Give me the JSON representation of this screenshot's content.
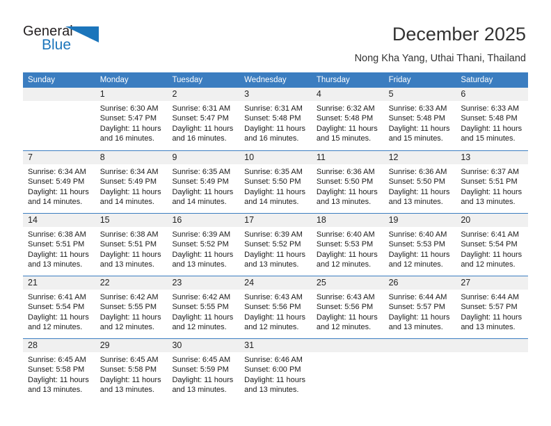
{
  "logo": {
    "word_top": "General",
    "word_bottom": "Blue",
    "accent_color": "#1b75bb",
    "text_color": "#231f20",
    "triangle_icon": "blue-triangle-icon"
  },
  "header": {
    "title": "December 2025",
    "subtitle": "Nong Kha Yang, Uthai Thani, Thailand",
    "header_bar_color": "#3b7dc0",
    "daynum_strip_color": "#f0f0f0"
  },
  "weekdays": [
    "Sunday",
    "Monday",
    "Tuesday",
    "Wednesday",
    "Thursday",
    "Friday",
    "Saturday"
  ],
  "weeks": [
    [
      {
        "day": "",
        "sunrise": "",
        "sunset": "",
        "daylight": "",
        "daylight2": "",
        "empty": true
      },
      {
        "day": "1",
        "sunrise": "Sunrise: 6:30 AM",
        "sunset": "Sunset: 5:47 PM",
        "daylight": "Daylight: 11 hours",
        "daylight2": "and 16 minutes."
      },
      {
        "day": "2",
        "sunrise": "Sunrise: 6:31 AM",
        "sunset": "Sunset: 5:47 PM",
        "daylight": "Daylight: 11 hours",
        "daylight2": "and 16 minutes."
      },
      {
        "day": "3",
        "sunrise": "Sunrise: 6:31 AM",
        "sunset": "Sunset: 5:48 PM",
        "daylight": "Daylight: 11 hours",
        "daylight2": "and 16 minutes."
      },
      {
        "day": "4",
        "sunrise": "Sunrise: 6:32 AM",
        "sunset": "Sunset: 5:48 PM",
        "daylight": "Daylight: 11 hours",
        "daylight2": "and 15 minutes."
      },
      {
        "day": "5",
        "sunrise": "Sunrise: 6:33 AM",
        "sunset": "Sunset: 5:48 PM",
        "daylight": "Daylight: 11 hours",
        "daylight2": "and 15 minutes."
      },
      {
        "day": "6",
        "sunrise": "Sunrise: 6:33 AM",
        "sunset": "Sunset: 5:48 PM",
        "daylight": "Daylight: 11 hours",
        "daylight2": "and 15 minutes."
      }
    ],
    [
      {
        "day": "7",
        "sunrise": "Sunrise: 6:34 AM",
        "sunset": "Sunset: 5:49 PM",
        "daylight": "Daylight: 11 hours",
        "daylight2": "and 14 minutes."
      },
      {
        "day": "8",
        "sunrise": "Sunrise: 6:34 AM",
        "sunset": "Sunset: 5:49 PM",
        "daylight": "Daylight: 11 hours",
        "daylight2": "and 14 minutes."
      },
      {
        "day": "9",
        "sunrise": "Sunrise: 6:35 AM",
        "sunset": "Sunset: 5:49 PM",
        "daylight": "Daylight: 11 hours",
        "daylight2": "and 14 minutes."
      },
      {
        "day": "10",
        "sunrise": "Sunrise: 6:35 AM",
        "sunset": "Sunset: 5:50 PM",
        "daylight": "Daylight: 11 hours",
        "daylight2": "and 14 minutes."
      },
      {
        "day": "11",
        "sunrise": "Sunrise: 6:36 AM",
        "sunset": "Sunset: 5:50 PM",
        "daylight": "Daylight: 11 hours",
        "daylight2": "and 13 minutes."
      },
      {
        "day": "12",
        "sunrise": "Sunrise: 6:36 AM",
        "sunset": "Sunset: 5:50 PM",
        "daylight": "Daylight: 11 hours",
        "daylight2": "and 13 minutes."
      },
      {
        "day": "13",
        "sunrise": "Sunrise: 6:37 AM",
        "sunset": "Sunset: 5:51 PM",
        "daylight": "Daylight: 11 hours",
        "daylight2": "and 13 minutes."
      }
    ],
    [
      {
        "day": "14",
        "sunrise": "Sunrise: 6:38 AM",
        "sunset": "Sunset: 5:51 PM",
        "daylight": "Daylight: 11 hours",
        "daylight2": "and 13 minutes."
      },
      {
        "day": "15",
        "sunrise": "Sunrise: 6:38 AM",
        "sunset": "Sunset: 5:51 PM",
        "daylight": "Daylight: 11 hours",
        "daylight2": "and 13 minutes."
      },
      {
        "day": "16",
        "sunrise": "Sunrise: 6:39 AM",
        "sunset": "Sunset: 5:52 PM",
        "daylight": "Daylight: 11 hours",
        "daylight2": "and 13 minutes."
      },
      {
        "day": "17",
        "sunrise": "Sunrise: 6:39 AM",
        "sunset": "Sunset: 5:52 PM",
        "daylight": "Daylight: 11 hours",
        "daylight2": "and 13 minutes."
      },
      {
        "day": "18",
        "sunrise": "Sunrise: 6:40 AM",
        "sunset": "Sunset: 5:53 PM",
        "daylight": "Daylight: 11 hours",
        "daylight2": "and 12 minutes."
      },
      {
        "day": "19",
        "sunrise": "Sunrise: 6:40 AM",
        "sunset": "Sunset: 5:53 PM",
        "daylight": "Daylight: 11 hours",
        "daylight2": "and 12 minutes."
      },
      {
        "day": "20",
        "sunrise": "Sunrise: 6:41 AM",
        "sunset": "Sunset: 5:54 PM",
        "daylight": "Daylight: 11 hours",
        "daylight2": "and 12 minutes."
      }
    ],
    [
      {
        "day": "21",
        "sunrise": "Sunrise: 6:41 AM",
        "sunset": "Sunset: 5:54 PM",
        "daylight": "Daylight: 11 hours",
        "daylight2": "and 12 minutes."
      },
      {
        "day": "22",
        "sunrise": "Sunrise: 6:42 AM",
        "sunset": "Sunset: 5:55 PM",
        "daylight": "Daylight: 11 hours",
        "daylight2": "and 12 minutes."
      },
      {
        "day": "23",
        "sunrise": "Sunrise: 6:42 AM",
        "sunset": "Sunset: 5:55 PM",
        "daylight": "Daylight: 11 hours",
        "daylight2": "and 12 minutes."
      },
      {
        "day": "24",
        "sunrise": "Sunrise: 6:43 AM",
        "sunset": "Sunset: 5:56 PM",
        "daylight": "Daylight: 11 hours",
        "daylight2": "and 12 minutes."
      },
      {
        "day": "25",
        "sunrise": "Sunrise: 6:43 AM",
        "sunset": "Sunset: 5:56 PM",
        "daylight": "Daylight: 11 hours",
        "daylight2": "and 12 minutes."
      },
      {
        "day": "26",
        "sunrise": "Sunrise: 6:44 AM",
        "sunset": "Sunset: 5:57 PM",
        "daylight": "Daylight: 11 hours",
        "daylight2": "and 13 minutes."
      },
      {
        "day": "27",
        "sunrise": "Sunrise: 6:44 AM",
        "sunset": "Sunset: 5:57 PM",
        "daylight": "Daylight: 11 hours",
        "daylight2": "and 13 minutes."
      }
    ],
    [
      {
        "day": "28",
        "sunrise": "Sunrise: 6:45 AM",
        "sunset": "Sunset: 5:58 PM",
        "daylight": "Daylight: 11 hours",
        "daylight2": "and 13 minutes."
      },
      {
        "day": "29",
        "sunrise": "Sunrise: 6:45 AM",
        "sunset": "Sunset: 5:58 PM",
        "daylight": "Daylight: 11 hours",
        "daylight2": "and 13 minutes."
      },
      {
        "day": "30",
        "sunrise": "Sunrise: 6:45 AM",
        "sunset": "Sunset: 5:59 PM",
        "daylight": "Daylight: 11 hours",
        "daylight2": "and 13 minutes."
      },
      {
        "day": "31",
        "sunrise": "Sunrise: 6:46 AM",
        "sunset": "Sunset: 6:00 PM",
        "daylight": "Daylight: 11 hours",
        "daylight2": "and 13 minutes."
      },
      {
        "day": "",
        "sunrise": "",
        "sunset": "",
        "daylight": "",
        "daylight2": "",
        "empty": true
      },
      {
        "day": "",
        "sunrise": "",
        "sunset": "",
        "daylight": "",
        "daylight2": "",
        "empty": true
      },
      {
        "day": "",
        "sunrise": "",
        "sunset": "",
        "daylight": "",
        "daylight2": "",
        "empty": true
      }
    ]
  ]
}
